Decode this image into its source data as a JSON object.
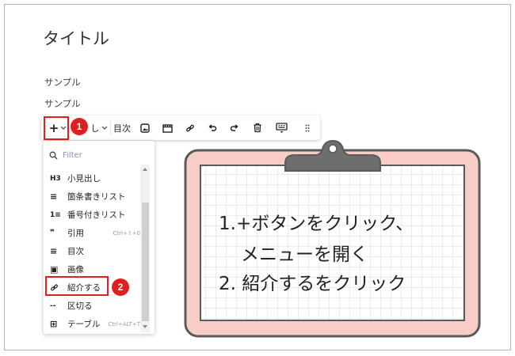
{
  "editor": {
    "title": "タイトル",
    "paragraphs": [
      "サンプル",
      "サンプル"
    ]
  },
  "toolbar": {
    "add_label": "+",
    "heading_label": "し",
    "toc_label": "目次",
    "add_icon": "plus-chevron-icon",
    "items": [
      "image-icon",
      "video-icon",
      "link-icon",
      "undo-icon",
      "redo-icon",
      "trash-icon",
      "keyboard-icon",
      "drag-handle-icon"
    ]
  },
  "menu": {
    "filter_placeholder": "Filter",
    "items": [
      {
        "icon": "H3",
        "label": "小見出し",
        "shortcut": ""
      },
      {
        "icon": "≡",
        "label": "箇条書きリスト",
        "shortcut": ""
      },
      {
        "icon": "1≡",
        "label": "番号付きリスト",
        "shortcut": ""
      },
      {
        "icon": "❞",
        "label": "引用",
        "shortcut": "Ctrl+⇧+0"
      },
      {
        "icon": "≡",
        "label": "目次",
        "shortcut": ""
      },
      {
        "icon": "▣",
        "label": "画像",
        "shortcut": ""
      },
      {
        "icon": "🔗",
        "label": "紹介する",
        "shortcut": ""
      },
      {
        "icon": "--",
        "label": "区切る",
        "shortcut": ""
      },
      {
        "icon": "⊞",
        "label": "テーブル",
        "shortcut": "Ctrl+ALT+T"
      }
    ]
  },
  "badges": [
    "1",
    "2"
  ],
  "callout": {
    "lines": [
      "1.+ボタンをクリック、",
      "メニューを開く",
      "2. 紹介するをクリック"
    ],
    "board_color": "#f8cdc7",
    "border_color": "#5a5a5a"
  },
  "colors": {
    "highlight": "#e01f1f"
  }
}
